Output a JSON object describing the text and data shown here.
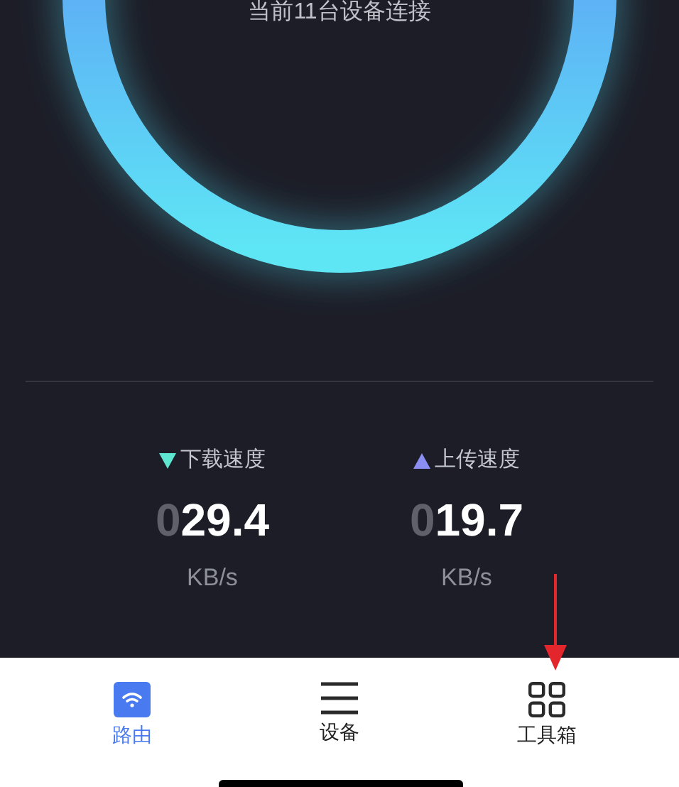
{
  "status_text": "当前11台设备连接",
  "speeds": [
    {
      "kind": "download",
      "label": "下载速度",
      "leading": "0",
      "value": "29.4",
      "unit": "KB/s"
    },
    {
      "kind": "upload",
      "label": "上传速度",
      "leading": "0",
      "value": "19.7",
      "unit": "KB/s"
    }
  ],
  "tabs": [
    {
      "kind": "router",
      "label": "路由",
      "selected": true
    },
    {
      "kind": "devices",
      "label": "设备",
      "selected": false
    },
    {
      "kind": "tools",
      "label": "工具箱",
      "selected": false
    }
  ]
}
